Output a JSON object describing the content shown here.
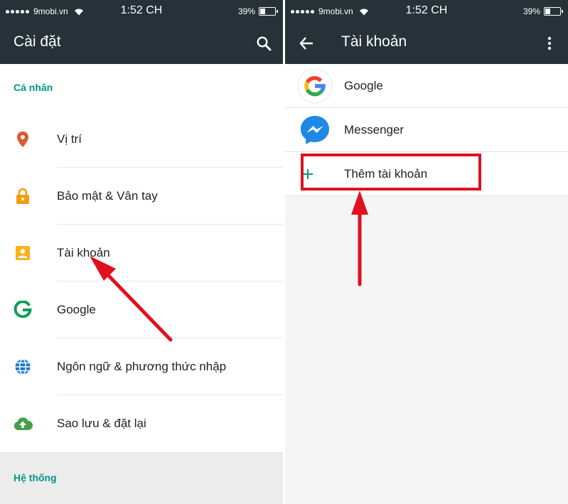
{
  "left": {
    "status": {
      "carrier": "9mobi.vn",
      "time": "1:52 CH",
      "battery": "39%",
      "battery_level": 0.39
    },
    "toolbar": {
      "title": "Cài đặt",
      "search_icon": "search-icon"
    },
    "sections": [
      {
        "header": "Cá nhân",
        "items": [
          {
            "label": "Vị trí",
            "icon": "location-pin-icon",
            "color": "#e2562c"
          },
          {
            "label": "Bảo mật & Vân tay",
            "icon": "lock-icon",
            "color": "#f39c12"
          },
          {
            "label": "Tài khoản",
            "icon": "account-icon",
            "color": "#f9b21a"
          },
          {
            "label": "Google",
            "icon": "google-g-icon",
            "color": "#0f9d58"
          },
          {
            "label": "Ngôn ngữ & phương thức nhập",
            "icon": "globe-icon",
            "color": "#1976d2"
          },
          {
            "label": "Sao lưu & đặt lại",
            "icon": "cloud-upload-icon",
            "color": "#43a047"
          }
        ]
      },
      {
        "header": "Hệ thống"
      }
    ]
  },
  "right": {
    "status": {
      "carrier": "9mobi.vn",
      "time": "1:52 CH",
      "battery": "39%",
      "battery_level": 0.39
    },
    "toolbar": {
      "title": "Tài khoản",
      "back_icon": "arrow-back-icon",
      "more_icon": "more-vert-icon"
    },
    "accounts": [
      {
        "label": "Google",
        "icon": "google-logo-icon"
      },
      {
        "label": "Messenger",
        "icon": "messenger-icon"
      }
    ],
    "add_account": {
      "label": "Thêm tài khoản",
      "icon": "plus-icon",
      "color": "#009688"
    }
  },
  "annotation": {
    "color": "#e0101e"
  }
}
